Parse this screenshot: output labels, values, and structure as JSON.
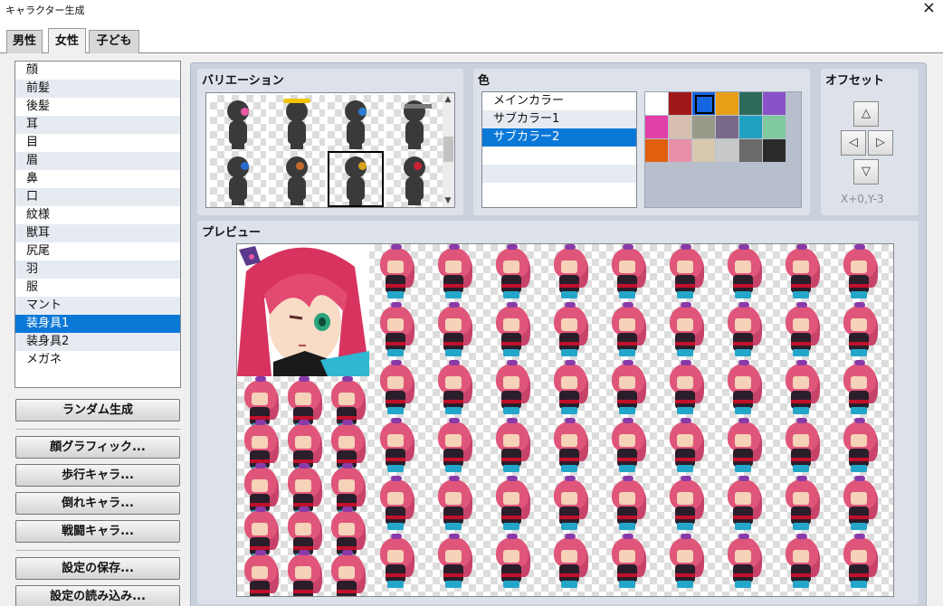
{
  "window": {
    "title": "キャラクター生成",
    "close_icon": "×"
  },
  "tabs": [
    {
      "label": "男性",
      "active": false
    },
    {
      "label": "女性",
      "active": true
    },
    {
      "label": "子ども",
      "active": false
    }
  ],
  "parts": [
    {
      "label": "顔",
      "selected": false
    },
    {
      "label": "前髪",
      "selected": false
    },
    {
      "label": "後髪",
      "selected": false
    },
    {
      "label": "耳",
      "selected": false
    },
    {
      "label": "目",
      "selected": false
    },
    {
      "label": "眉",
      "selected": false
    },
    {
      "label": "鼻",
      "selected": false
    },
    {
      "label": "口",
      "selected": false
    },
    {
      "label": "紋様",
      "selected": false
    },
    {
      "label": "獣耳",
      "selected": false
    },
    {
      "label": "尻尾",
      "selected": false
    },
    {
      "label": "羽",
      "selected": false
    },
    {
      "label": "服",
      "selected": false
    },
    {
      "label": "マント",
      "selected": false
    },
    {
      "label": "装身具1",
      "selected": true
    },
    {
      "label": "装身具2",
      "selected": false
    },
    {
      "label": "メガネ",
      "selected": false
    }
  ],
  "buttons": {
    "random": "ランダム生成",
    "face_graphic": "顔グラフィック...",
    "walk_char": "歩行キャラ...",
    "fallen_char": "倒れキャラ...",
    "battle_char": "戦闘キャラ...",
    "save_settings": "設定の保存...",
    "load_settings": "設定の読み込み..."
  },
  "variation": {
    "title": "バリエーション",
    "selected_index": 6,
    "accessory_colors": [
      "#e85aa8",
      "#f2c400",
      "#2a7fd4",
      "#7a7a7a",
      "#2a6ad0",
      "#c46a2a",
      "#d6a21a",
      "#cc2233"
    ]
  },
  "color": {
    "title": "色",
    "items": [
      {
        "label": "メインカラー",
        "selected": false
      },
      {
        "label": "サブカラー1",
        "selected": false
      },
      {
        "label": "サブカラー2",
        "selected": true
      }
    ],
    "swatches": [
      "#ffffff",
      "#a01818",
      "#1565e0",
      "#e8a018",
      "#2e6a5a",
      "#8a52c8",
      "#e040a8",
      "#d8c0b0",
      "#9a9a8a",
      "#7a6a8a",
      "#20a0c0",
      "#80c8a0",
      "#e06010",
      "#e890a8",
      "#d8c8b0",
      "#c8c8c8",
      "#6a6a6a",
      "#2a2a2a"
    ],
    "selected_swatch": 2
  },
  "offset": {
    "title": "オフセット",
    "up_icon": "△",
    "left_icon": "◁",
    "right_icon": "▷",
    "down_icon": "▽",
    "value": "X+0,Y-3"
  },
  "preview": {
    "title": "プレビュー"
  }
}
